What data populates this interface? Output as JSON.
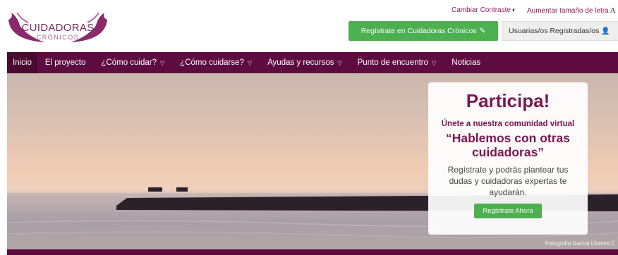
{
  "logo": {
    "main": "CUIDADORAS",
    "sub": "CRÓNICOS"
  },
  "utility": {
    "contrast_label": "Cambiar Contraste",
    "contrast_icon": "contrast-icon",
    "font_label": "Aumentar tamaño de letra",
    "font_icon_glyph": "A"
  },
  "header_buttons": {
    "register_label": "Regístrate en Cuidadoras Crónicos",
    "register_icon": "pencil-icon",
    "users_label": "Usuarias/os Registradas/os",
    "users_icon": "user-icon"
  },
  "nav": {
    "items": [
      {
        "label": "Inicio",
        "dropdown": false
      },
      {
        "label": "El proyecto",
        "dropdown": false
      },
      {
        "label": "¿Cómo cuidar?",
        "dropdown": true
      },
      {
        "label": "¿Cómo cuidarse?",
        "dropdown": true
      },
      {
        "label": "Ayudas y recursos",
        "dropdown": true
      },
      {
        "label": "Punto de encuentro",
        "dropdown": true
      },
      {
        "label": "Noticias",
        "dropdown": false
      }
    ]
  },
  "hero": {
    "photo_credit": "Fotografía García Llorens C",
    "promo": {
      "title": "Participa!",
      "subtitle": "Únete a nuestra comunidad virtual",
      "quote": "“Hablemos con otras cuidadoras”",
      "body": "Regístrate y podrás plantear tus dudas y cuidadoras expertas te ayudarán.",
      "button": "Regístrate Ahora"
    }
  },
  "colors": {
    "brand": "#5e0c3f",
    "accent_text": "#7a1850",
    "green": "#4caf50"
  }
}
